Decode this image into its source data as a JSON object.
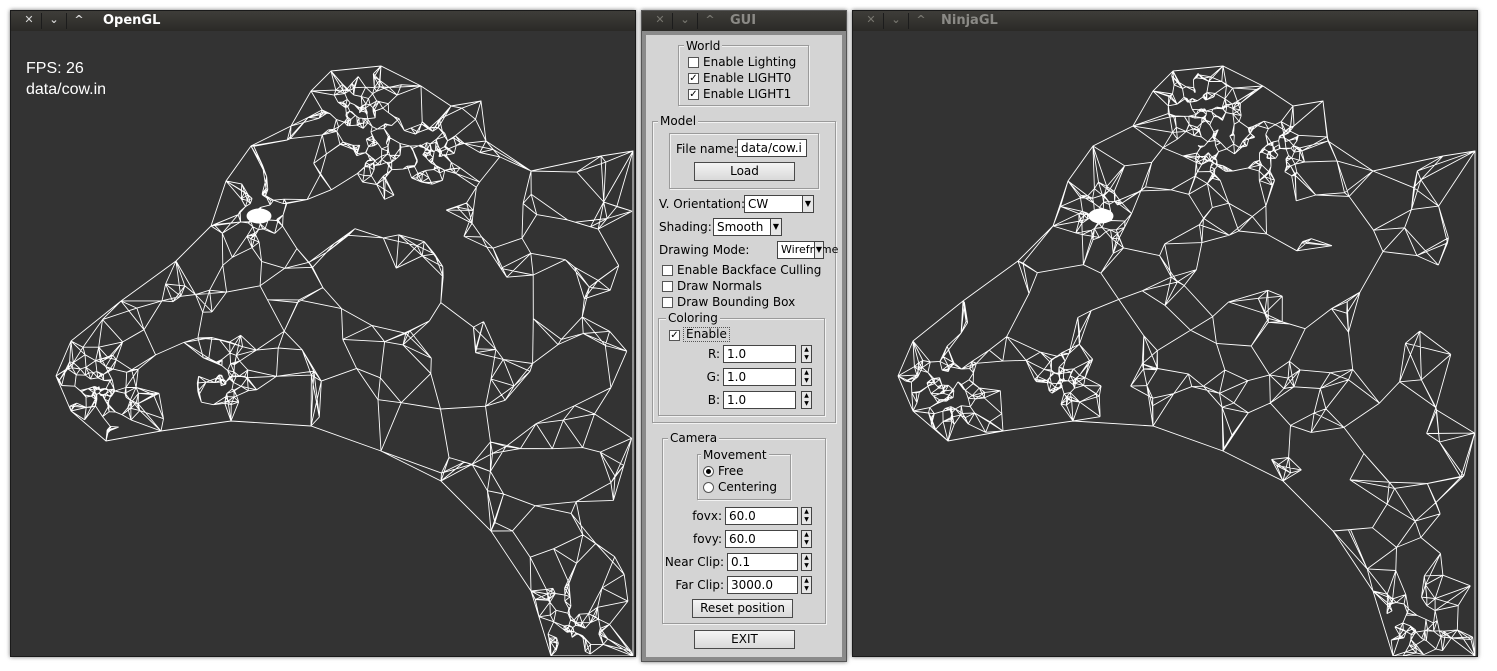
{
  "left_window": {
    "title": "OpenGL",
    "fps_text": "FPS: 26",
    "file_text": "data/cow.in"
  },
  "gui_window": {
    "title": "GUI",
    "world": {
      "legend": "World",
      "enable_lighting": {
        "label": "Enable Lighting",
        "checked": false
      },
      "enable_light0": {
        "label": "Enable LIGHT0",
        "checked": true
      },
      "enable_light1": {
        "label": "Enable LIGHT1",
        "checked": true
      }
    },
    "model": {
      "legend": "Model",
      "file_name_label": "File name:",
      "file_name_value": "data/cow.i",
      "load_label": "Load",
      "orientation_label": "V. Orientation:",
      "orientation_value": "CW",
      "shading_label": "Shading:",
      "shading_value": "Smooth",
      "drawing_mode_label": "Drawing Mode:",
      "drawing_mode_value": "Wireframe",
      "backface_culling": {
        "label": "Enable Backface Culling",
        "checked": false
      },
      "draw_normals": {
        "label": "Draw Normals",
        "checked": false
      },
      "draw_bounding_box": {
        "label": "Draw Bounding Box",
        "checked": false
      },
      "coloring": {
        "legend": "Coloring",
        "enable": {
          "label": "Enable",
          "checked": true
        },
        "r_label": "R:",
        "r_value": "1.0",
        "g_label": "G:",
        "g_value": "1.0",
        "b_label": "B:",
        "b_value": "1.0"
      }
    },
    "camera": {
      "legend": "Camera",
      "movement_legend": "Movement",
      "free_label": "Free",
      "centering_label": "Centering",
      "selected_movement": "Free",
      "fovx_label": "fovx:",
      "fovx_value": "60.0",
      "fovy_label": "fovy:",
      "fovy_value": "60.0",
      "near_clip_label": "Near Clip:",
      "near_clip_value": "0.1",
      "far_clip_label": "Far Clip:",
      "far_clip_value": "3000.0",
      "reset_label": "Reset position"
    },
    "exit_label": "EXIT"
  },
  "right_window": {
    "title": "NinjaGL"
  },
  "icons": {
    "close": "close-icon",
    "minimize": "chevron-down-icon",
    "maximize": "chevron-up-icon"
  },
  "colors": {
    "viewport_bg": "#333333",
    "wireframe": "#ffffff",
    "gui_bg": "#d4d4d4"
  }
}
